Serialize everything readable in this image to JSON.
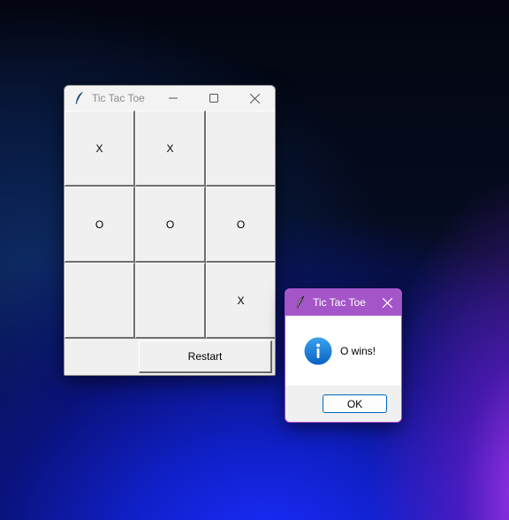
{
  "main_window": {
    "title": "Tic Tac Toe",
    "icon": "feather-icon",
    "controls": [
      "minimize-icon",
      "maximize-icon",
      "close-icon"
    ],
    "board": [
      [
        "X",
        "X",
        ""
      ],
      [
        "O",
        "O",
        "O"
      ],
      [
        "",
        "",
        "X"
      ]
    ],
    "restart_label": "Restart"
  },
  "dialog": {
    "title": "Tic Tac Toe",
    "icon": "feather-icon",
    "message_icon": "info-icon",
    "message": "O wins!",
    "ok_label": "OK",
    "accent": "#a456c8"
  }
}
